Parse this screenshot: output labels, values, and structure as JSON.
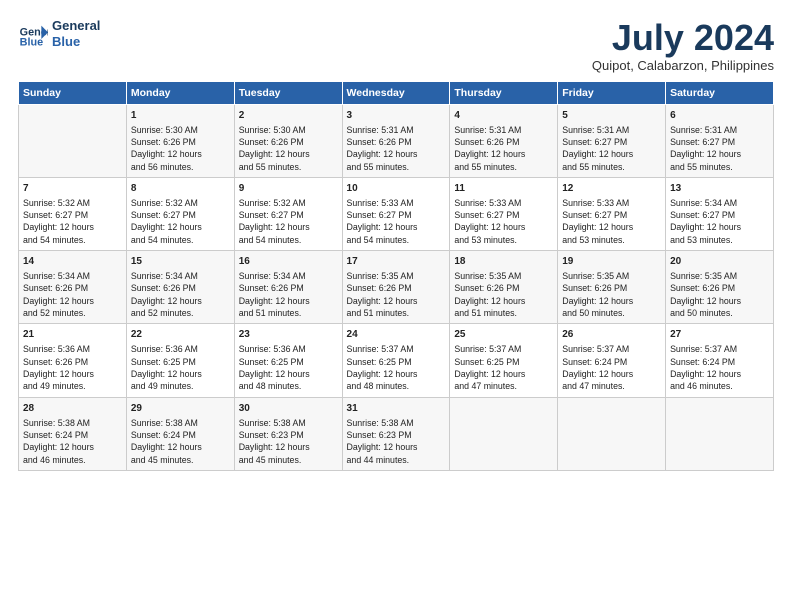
{
  "logo": {
    "line1": "General",
    "line2": "Blue"
  },
  "title": "July 2024",
  "subtitle": "Quipot, Calabarzon, Philippines",
  "columns": [
    "Sunday",
    "Monday",
    "Tuesday",
    "Wednesday",
    "Thursday",
    "Friday",
    "Saturday"
  ],
  "weeks": [
    [
      {
        "day": "",
        "info": ""
      },
      {
        "day": "1",
        "info": "Sunrise: 5:30 AM\nSunset: 6:26 PM\nDaylight: 12 hours\nand 56 minutes."
      },
      {
        "day": "2",
        "info": "Sunrise: 5:30 AM\nSunset: 6:26 PM\nDaylight: 12 hours\nand 55 minutes."
      },
      {
        "day": "3",
        "info": "Sunrise: 5:31 AM\nSunset: 6:26 PM\nDaylight: 12 hours\nand 55 minutes."
      },
      {
        "day": "4",
        "info": "Sunrise: 5:31 AM\nSunset: 6:26 PM\nDaylight: 12 hours\nand 55 minutes."
      },
      {
        "day": "5",
        "info": "Sunrise: 5:31 AM\nSunset: 6:27 PM\nDaylight: 12 hours\nand 55 minutes."
      },
      {
        "day": "6",
        "info": "Sunrise: 5:31 AM\nSunset: 6:27 PM\nDaylight: 12 hours\nand 55 minutes."
      }
    ],
    [
      {
        "day": "7",
        "info": "Sunrise: 5:32 AM\nSunset: 6:27 PM\nDaylight: 12 hours\nand 54 minutes."
      },
      {
        "day": "8",
        "info": "Sunrise: 5:32 AM\nSunset: 6:27 PM\nDaylight: 12 hours\nand 54 minutes."
      },
      {
        "day": "9",
        "info": "Sunrise: 5:32 AM\nSunset: 6:27 PM\nDaylight: 12 hours\nand 54 minutes."
      },
      {
        "day": "10",
        "info": "Sunrise: 5:33 AM\nSunset: 6:27 PM\nDaylight: 12 hours\nand 54 minutes."
      },
      {
        "day": "11",
        "info": "Sunrise: 5:33 AM\nSunset: 6:27 PM\nDaylight: 12 hours\nand 53 minutes."
      },
      {
        "day": "12",
        "info": "Sunrise: 5:33 AM\nSunset: 6:27 PM\nDaylight: 12 hours\nand 53 minutes."
      },
      {
        "day": "13",
        "info": "Sunrise: 5:34 AM\nSunset: 6:27 PM\nDaylight: 12 hours\nand 53 minutes."
      }
    ],
    [
      {
        "day": "14",
        "info": "Sunrise: 5:34 AM\nSunset: 6:26 PM\nDaylight: 12 hours\nand 52 minutes."
      },
      {
        "day": "15",
        "info": "Sunrise: 5:34 AM\nSunset: 6:26 PM\nDaylight: 12 hours\nand 52 minutes."
      },
      {
        "day": "16",
        "info": "Sunrise: 5:34 AM\nSunset: 6:26 PM\nDaylight: 12 hours\nand 51 minutes."
      },
      {
        "day": "17",
        "info": "Sunrise: 5:35 AM\nSunset: 6:26 PM\nDaylight: 12 hours\nand 51 minutes."
      },
      {
        "day": "18",
        "info": "Sunrise: 5:35 AM\nSunset: 6:26 PM\nDaylight: 12 hours\nand 51 minutes."
      },
      {
        "day": "19",
        "info": "Sunrise: 5:35 AM\nSunset: 6:26 PM\nDaylight: 12 hours\nand 50 minutes."
      },
      {
        "day": "20",
        "info": "Sunrise: 5:35 AM\nSunset: 6:26 PM\nDaylight: 12 hours\nand 50 minutes."
      }
    ],
    [
      {
        "day": "21",
        "info": "Sunrise: 5:36 AM\nSunset: 6:26 PM\nDaylight: 12 hours\nand 49 minutes."
      },
      {
        "day": "22",
        "info": "Sunrise: 5:36 AM\nSunset: 6:25 PM\nDaylight: 12 hours\nand 49 minutes."
      },
      {
        "day": "23",
        "info": "Sunrise: 5:36 AM\nSunset: 6:25 PM\nDaylight: 12 hours\nand 48 minutes."
      },
      {
        "day": "24",
        "info": "Sunrise: 5:37 AM\nSunset: 6:25 PM\nDaylight: 12 hours\nand 48 minutes."
      },
      {
        "day": "25",
        "info": "Sunrise: 5:37 AM\nSunset: 6:25 PM\nDaylight: 12 hours\nand 47 minutes."
      },
      {
        "day": "26",
        "info": "Sunrise: 5:37 AM\nSunset: 6:24 PM\nDaylight: 12 hours\nand 47 minutes."
      },
      {
        "day": "27",
        "info": "Sunrise: 5:37 AM\nSunset: 6:24 PM\nDaylight: 12 hours\nand 46 minutes."
      }
    ],
    [
      {
        "day": "28",
        "info": "Sunrise: 5:38 AM\nSunset: 6:24 PM\nDaylight: 12 hours\nand 46 minutes."
      },
      {
        "day": "29",
        "info": "Sunrise: 5:38 AM\nSunset: 6:24 PM\nDaylight: 12 hours\nand 45 minutes."
      },
      {
        "day": "30",
        "info": "Sunrise: 5:38 AM\nSunset: 6:23 PM\nDaylight: 12 hours\nand 45 minutes."
      },
      {
        "day": "31",
        "info": "Sunrise: 5:38 AM\nSunset: 6:23 PM\nDaylight: 12 hours\nand 44 minutes."
      },
      {
        "day": "",
        "info": ""
      },
      {
        "day": "",
        "info": ""
      },
      {
        "day": "",
        "info": ""
      }
    ]
  ]
}
